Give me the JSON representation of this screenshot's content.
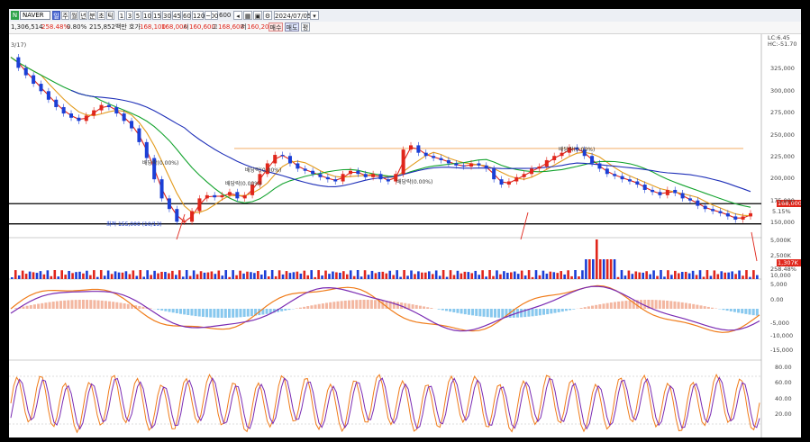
{
  "toolbar": {
    "symbol": "NAVER",
    "period_buttons": [
      "일",
      "주",
      "월",
      "년",
      "분",
      "초",
      "틱"
    ],
    "selected_period": "일",
    "interval_buttons": [
      "1",
      "3",
      "5",
      "10",
      "15",
      "30",
      "45",
      "60",
      "120",
      "~"
    ],
    "count_value": "600",
    "count_total": "600",
    "date": "2024/07/05",
    "buy_label": "매수",
    "sell_label": "매도",
    "avg_label": "평"
  },
  "infobar": {
    "volume": "1,306,514",
    "volume_pct": "258.48%",
    "change_pct": "0.80%",
    "amount": "215,852백만",
    "quote_label": "호가",
    "ask": "168,100",
    "bid": "168,000",
    "open_label": "시",
    "open": "160,600",
    "high_label": "고",
    "high": "168,600",
    "low_label": "저",
    "low": "160,200"
  },
  "chart_data": {
    "type": "line",
    "panels": [
      {
        "name": "price",
        "y_ticks": [
          "325,000",
          "300,000",
          "275,000",
          "250,000",
          "225,000",
          "200,000",
          "175,000",
          "150,000"
        ],
        "ylim": [
          145000,
          335000
        ],
        "close": [
          315000,
          305000,
          298000,
          290000,
          283000,
          275000,
          268000,
          262000,
          258000,
          255000,
          260000,
          265000,
          270000,
          268000,
          262000,
          255000,
          248000,
          235000,
          220000,
          200000,
          182000,
          172000,
          160000,
          160000,
          170000,
          182000,
          185000,
          183000,
          185000,
          188000,
          182000,
          185000,
          195000,
          205000,
          215000,
          223000,
          222000,
          215000,
          210000,
          208000,
          205000,
          202000,
          200000,
          198000,
          205000,
          208000,
          205000,
          202000,
          205000,
          200000,
          198000,
          205000,
          228000,
          232000,
          225000,
          222000,
          220000,
          218000,
          215000,
          213000,
          212000,
          215000,
          213000,
          210000,
          200000,
          195000,
          198000,
          202000,
          205000,
          210000,
          212000,
          218000,
          222000,
          225000,
          230000,
          228000,
          222000,
          215000,
          210000,
          205000,
          203000,
          200000,
          198000,
          195000,
          190000,
          188000,
          185000,
          190000,
          187000,
          182000,
          180000,
          175000,
          172000,
          170000,
          168000,
          165000,
          162000,
          165000,
          168000
        ],
        "lines": [
          {
            "name": "MA5",
            "color": "#e0261b"
          },
          {
            "name": "MA20",
            "color": "#e39b1c"
          },
          {
            "name": "MA60",
            "color": "#13a32e"
          },
          {
            "name": "MA120",
            "color": "#1e2fb8"
          }
        ],
        "annotations": [
          "최저 155,000 (10/13)",
          "배당락(0.00%)",
          "배당락(0.00%)",
          "배당락(0.00%)",
          "배당락(0.00%)",
          "배당락(0.00%)"
        ],
        "left_label": "3/17)",
        "right_top_labels": [
          "LC:6.45",
          "HC:-51.70"
        ],
        "price_badge": "168,000",
        "price_badge_sub": "5.15%",
        "support_lines": [
          177000,
          158000
        ],
        "resistance_line": 229000
      },
      {
        "name": "volume",
        "y_ticks": [
          "5,000K",
          "2,500K"
        ],
        "badge": "1,307K",
        "badge_sub": "258.48%"
      },
      {
        "name": "macd",
        "y_ticks": [
          "5,000",
          "0.00",
          "-5,000",
          "-10,000",
          "-15,000"
        ],
        "top_tick": "10,000"
      },
      {
        "name": "stochastic",
        "y_ticks": [
          "80.00",
          "60.00",
          "40.00",
          "20.00"
        ]
      }
    ]
  }
}
